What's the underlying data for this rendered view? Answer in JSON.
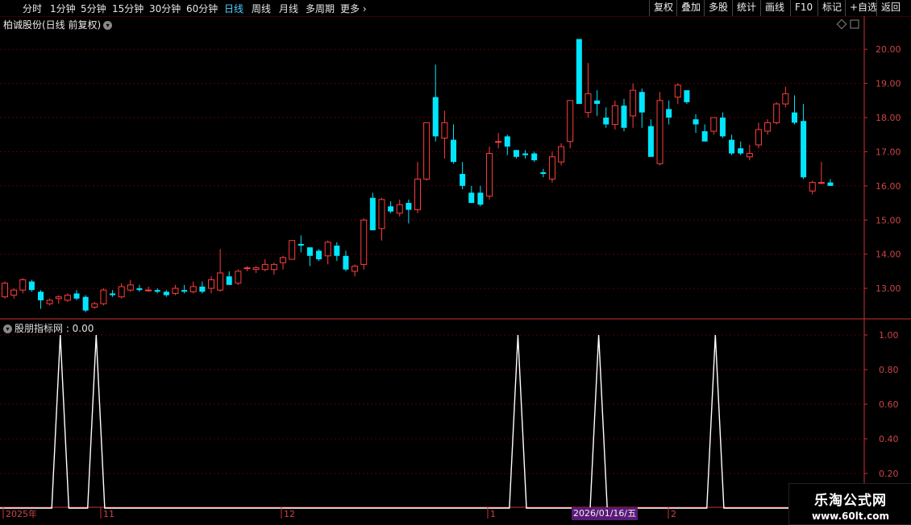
{
  "toolbar": {
    "periods": [
      "分时",
      "1分钟",
      "5分钟",
      "15分钟",
      "30分钟",
      "60分钟",
      "日线",
      "周线",
      "月线",
      "多周期",
      "更多"
    ],
    "active": "日线",
    "right_buttons": [
      "复权",
      "叠加",
      "多股",
      "统计",
      "画线",
      "F10",
      "标记",
      "+自选",
      "返回"
    ]
  },
  "stock": {
    "title": "柏诚股份(日线 前复权)"
  },
  "indicator": {
    "title": "股朋指标网 : 0.00"
  },
  "x_axis": {
    "labels": [
      "2025年",
      "11",
      "12",
      "1",
      "2"
    ],
    "cursor_date": "2026/01/16/五"
  },
  "watermark": {
    "line1": "乐淘公式网",
    "line2": "www.60lt.com"
  },
  "colors": {
    "up": "#ff3d3d",
    "down": "#00e6ff",
    "grid": "#5a0000",
    "axis": "#cc3333",
    "line": "#ffffff"
  },
  "chart_data": [
    {
      "type": "candlestick",
      "title": "柏诚股份(日线 前复权)",
      "ylim": [
        12.2,
        20.5
      ],
      "yticks": [
        "13.00",
        "14.00",
        "15.00",
        "16.00",
        "17.00",
        "18.00",
        "19.00",
        "20.00"
      ],
      "ohlc": [
        [
          12.75,
          13.2,
          12.7,
          13.15
        ],
        [
          12.8,
          13.0,
          12.7,
          12.95
        ],
        [
          12.95,
          13.3,
          12.85,
          13.25
        ],
        [
          13.2,
          13.25,
          12.9,
          12.95
        ],
        [
          12.9,
          12.95,
          12.4,
          12.65
        ],
        [
          12.55,
          12.7,
          12.5,
          12.65
        ],
        [
          12.7,
          12.8,
          12.55,
          12.75
        ],
        [
          12.65,
          12.85,
          12.6,
          12.8
        ],
        [
          12.85,
          12.95,
          12.65,
          12.7
        ],
        [
          12.75,
          12.8,
          12.3,
          12.35
        ],
        [
          12.45,
          12.6,
          12.4,
          12.55
        ],
        [
          12.55,
          13.0,
          12.5,
          12.95
        ],
        [
          12.85,
          12.95,
          12.75,
          12.8
        ],
        [
          12.75,
          13.15,
          12.7,
          13.05
        ],
        [
          12.95,
          13.25,
          12.9,
          13.1
        ],
        [
          13.0,
          13.1,
          12.9,
          12.95
        ],
        [
          12.95,
          13.05,
          12.9,
          12.95
        ],
        [
          12.95,
          13.0,
          12.85,
          12.9
        ],
        [
          12.9,
          12.95,
          12.75,
          12.8
        ],
        [
          12.85,
          13.1,
          12.8,
          13.0
        ],
        [
          12.95,
          13.1,
          12.85,
          12.9
        ],
        [
          12.9,
          13.2,
          12.85,
          13.05
        ],
        [
          13.05,
          13.2,
          12.85,
          12.9
        ],
        [
          13.0,
          13.35,
          12.85,
          13.25
        ],
        [
          12.95,
          14.15,
          12.9,
          13.45
        ],
        [
          13.35,
          13.5,
          13.15,
          13.1
        ],
        [
          13.15,
          13.55,
          13.1,
          13.5
        ],
        [
          13.6,
          13.65,
          13.5,
          13.6
        ],
        [
          13.55,
          13.65,
          13.45,
          13.6
        ],
        [
          13.55,
          13.85,
          13.5,
          13.7
        ],
        [
          13.55,
          13.75,
          13.4,
          13.7
        ],
        [
          13.75,
          13.95,
          13.55,
          13.9
        ],
        [
          13.85,
          14.4,
          13.85,
          14.4
        ],
        [
          14.3,
          14.55,
          14.05,
          14.25
        ],
        [
          14.2,
          14.2,
          13.65,
          13.95
        ],
        [
          14.1,
          14.15,
          13.8,
          13.85
        ],
        [
          13.95,
          14.4,
          13.7,
          14.35
        ],
        [
          14.25,
          14.35,
          13.8,
          13.95
        ],
        [
          13.95,
          14.1,
          13.5,
          13.55
        ],
        [
          13.5,
          13.7,
          13.35,
          13.65
        ],
        [
          13.7,
          15.05,
          13.55,
          15.0
        ],
        [
          15.65,
          15.8,
          14.7,
          14.7
        ],
        [
          14.75,
          15.65,
          14.4,
          15.6
        ],
        [
          15.4,
          15.55,
          15.2,
          15.25
        ],
        [
          15.2,
          15.6,
          15.1,
          15.45
        ],
        [
          15.5,
          15.6,
          14.9,
          15.3
        ],
        [
          15.3,
          16.7,
          15.2,
          16.2
        ],
        [
          16.2,
          17.85,
          16.15,
          17.85
        ],
        [
          18.6,
          19.55,
          17.3,
          17.45
        ],
        [
          17.4,
          18.2,
          16.8,
          17.85
        ],
        [
          17.35,
          17.8,
          16.65,
          16.7
        ],
        [
          16.35,
          16.7,
          15.9,
          16.0
        ],
        [
          15.8,
          16.0,
          15.5,
          15.5
        ],
        [
          15.8,
          16.0,
          15.4,
          15.45
        ],
        [
          15.7,
          17.15,
          15.6,
          16.95
        ],
        [
          17.3,
          17.55,
          17.1,
          17.3
        ],
        [
          17.45,
          17.5,
          16.9,
          17.15
        ],
        [
          17.05,
          17.05,
          16.8,
          16.85
        ],
        [
          16.95,
          17.05,
          16.8,
          16.9
        ],
        [
          16.95,
          17.0,
          16.7,
          16.75
        ],
        [
          16.4,
          16.5,
          16.25,
          16.35
        ],
        [
          16.2,
          17.0,
          16.1,
          16.85
        ],
        [
          16.7,
          17.25,
          16.6,
          17.15
        ],
        [
          17.3,
          18.2,
          17.1,
          18.5
        ],
        [
          20.3,
          20.3,
          18.4,
          18.4
        ],
        [
          18.15,
          19.6,
          18.0,
          18.7
        ],
        [
          18.5,
          18.8,
          18.05,
          18.4
        ],
        [
          18.0,
          18.3,
          17.7,
          17.8
        ],
        [
          17.8,
          18.5,
          17.65,
          18.35
        ],
        [
          18.35,
          18.55,
          17.6,
          17.7
        ],
        [
          18.05,
          19.0,
          17.7,
          18.8
        ],
        [
          18.75,
          18.85,
          17.7,
          18.15
        ],
        [
          17.75,
          17.95,
          16.85,
          16.85
        ],
        [
          16.65,
          18.75,
          16.6,
          18.5
        ],
        [
          18.25,
          18.5,
          17.8,
          18.0
        ],
        [
          18.6,
          19.0,
          18.4,
          18.95
        ],
        [
          18.8,
          18.8,
          18.4,
          18.45
        ],
        [
          17.95,
          18.1,
          17.55,
          17.8
        ],
        [
          17.6,
          17.8,
          17.3,
          17.3
        ],
        [
          17.6,
          18.0,
          17.5,
          18.0
        ],
        [
          18.0,
          18.15,
          17.4,
          17.45
        ],
        [
          17.35,
          17.5,
          16.9,
          16.95
        ],
        [
          17.1,
          17.3,
          16.9,
          16.95
        ],
        [
          16.85,
          17.2,
          16.75,
          16.95
        ],
        [
          17.2,
          17.85,
          17.1,
          17.65
        ],
        [
          17.6,
          17.95,
          17.5,
          17.85
        ],
        [
          17.85,
          18.45,
          17.8,
          18.4
        ],
        [
          18.4,
          18.9,
          18.3,
          18.7
        ],
        [
          18.15,
          18.65,
          17.8,
          17.85
        ],
        [
          17.9,
          18.4,
          16.2,
          16.25
        ],
        [
          15.85,
          16.15,
          15.75,
          16.1
        ],
        [
          16.1,
          16.7,
          16.05,
          16.1
        ],
        [
          16.1,
          16.2,
          16.0,
          16.0
        ]
      ]
    },
    {
      "type": "line",
      "title": "股朋指标网",
      "ylim": [
        0,
        1
      ],
      "yticks": [
        "0.20",
        "0.40",
        "0.60",
        "0.80",
        "1.00"
      ],
      "peaks_at_index": [
        6,
        10,
        57,
        66,
        79
      ],
      "value": 0.0
    }
  ]
}
